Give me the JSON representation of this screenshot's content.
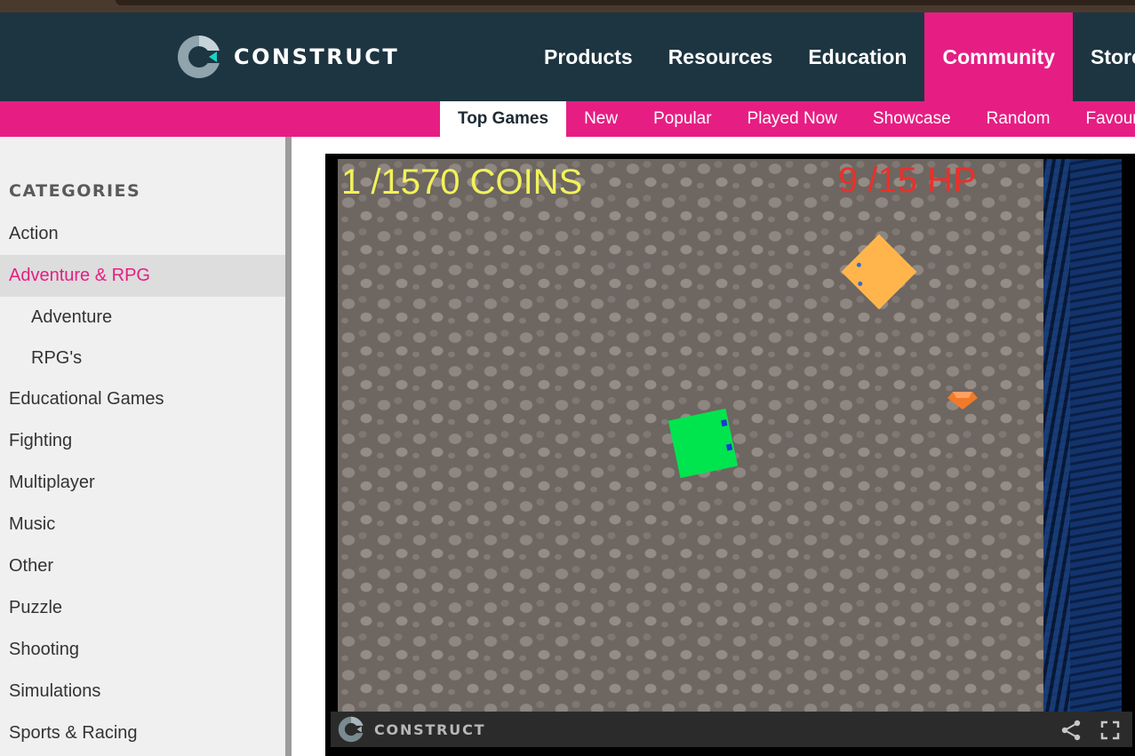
{
  "site": {
    "logo_text": "CONSTRUCT",
    "brand_color": "#e61e83",
    "nav_bg": "#1d3541"
  },
  "main_nav": [
    {
      "label": "Products"
    },
    {
      "label": "Resources"
    },
    {
      "label": "Education"
    },
    {
      "label": "Community",
      "active": true
    },
    {
      "label": "Store"
    }
  ],
  "sub_nav": [
    {
      "label": "Top Games",
      "active": true
    },
    {
      "label": "New"
    },
    {
      "label": "Popular"
    },
    {
      "label": "Played Now"
    },
    {
      "label": "Showcase"
    },
    {
      "label": "Random"
    },
    {
      "label": "Favourites"
    }
  ],
  "sidebar": {
    "heading": "CATEGORIES",
    "items": [
      {
        "label": "Action"
      },
      {
        "label": "Adventure & RPG",
        "active": true
      },
      {
        "label": "Adventure",
        "sub": true
      },
      {
        "label": "RPG's",
        "sub": true
      },
      {
        "label": "Educational Games"
      },
      {
        "label": "Fighting"
      },
      {
        "label": "Multiplayer"
      },
      {
        "label": "Music"
      },
      {
        "label": "Other"
      },
      {
        "label": "Puzzle"
      },
      {
        "label": "Shooting"
      },
      {
        "label": "Simulations"
      },
      {
        "label": "Sports & Racing"
      }
    ]
  },
  "game": {
    "coins_text": "1 /1570 COINS",
    "hp_text": "9 /15 HP",
    "coins_color": "#f2f25a",
    "hp_color": "#e8312a",
    "player_color": "#00e54e",
    "enemy_color": "#ffb54c"
  },
  "game_bar": {
    "logo_text": "CONSTRUCT",
    "icons": [
      "share-icon",
      "fullscreen-icon"
    ]
  }
}
